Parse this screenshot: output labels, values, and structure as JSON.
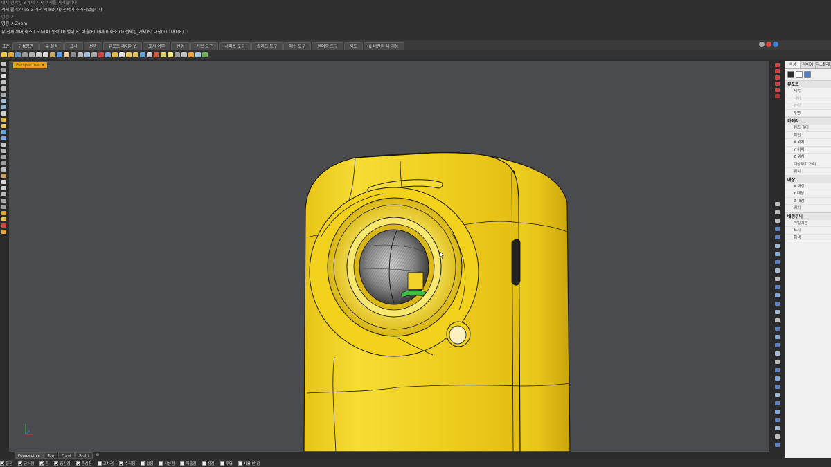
{
  "command_history": {
    "lines": [
      "배치 선택된 3 개의 가시 객체를 처리합니다",
      "객체 폴리서피스 3 개의 서브D(가) 선택에 추가되었습니다",
      "명령 ↗",
      "명령 ↗ Zoom"
    ],
    "prompt": "뷰 전체 확대/축소 ( 모두(A)  동적(D)  범위(E)  배율(F)  확대(I)  축소(O)  선택된_개체(S)  대상(T)  1대1(R) ):"
  },
  "tabs": [
    "표준",
    "구성평면",
    "뷰 설정",
    "표시",
    "선택",
    "뷰포트 레이아웃",
    "표시 여부",
    "변형",
    "커브 도구",
    "서피스 도구",
    "솔리드 도구",
    "메쉬 도구",
    "렌더링 도구",
    "제도",
    "8 버전의 새 기능"
  ],
  "viewport": {
    "label": "Perspective",
    "tabs": [
      "Perspective",
      "Top",
      "Front",
      "Right"
    ],
    "active_tab": "Perspective",
    "add_tab": "⊕"
  },
  "panel": {
    "tabs": [
      "속성",
      "레이어",
      "디스플레이"
    ],
    "sections": [
      {
        "title": "뷰포트",
        "rows": [
          {
            "label": "제목",
            "dim": false
          },
          {
            "label": "너비",
            "dim": true
          },
          {
            "label": "높이",
            "dim": true
          },
          {
            "label": "투영",
            "dim": false
          }
        ]
      },
      {
        "title": "카메라",
        "rows": [
          {
            "label": "렌즈 길이",
            "dim": false
          },
          {
            "label": "회전",
            "dim": false
          },
          {
            "label": "X 위치",
            "dim": false
          },
          {
            "label": "Y 위치",
            "dim": false
          },
          {
            "label": "Z 위치",
            "dim": false
          },
          {
            "label": "대상까지 거리",
            "dim": false
          },
          {
            "label": "위치",
            "dim": false
          }
        ]
      },
      {
        "title": "대상",
        "rows": [
          {
            "label": "X 대상",
            "dim": false
          },
          {
            "label": "Y 대상",
            "dim": false
          },
          {
            "label": "Z 대상",
            "dim": false
          },
          {
            "label": "위치",
            "dim": false
          }
        ]
      },
      {
        "title": "배경무늬",
        "rows": [
          {
            "label": "파일이름",
            "dim": false
          },
          {
            "label": "표시",
            "dim": false
          },
          {
            "label": "회색",
            "dim": false
          }
        ]
      }
    ]
  },
  "osnap": [
    {
      "label": "끝점",
      "checked": true
    },
    {
      "label": "근처점",
      "checked": true
    },
    {
      "label": "점",
      "checked": true
    },
    {
      "label": "중간점",
      "checked": true
    },
    {
      "label": "중심점",
      "checked": true
    },
    {
      "label": "교차점",
      "checked": false
    },
    {
      "label": "수직점",
      "checked": true
    },
    {
      "label": "접점",
      "checked": false
    },
    {
      "label": "사분점",
      "checked": false
    },
    {
      "label": "매듭점",
      "checked": false
    },
    {
      "label": "정점",
      "checked": false
    },
    {
      "label": "투영",
      "checked": false
    },
    {
      "label": "사용 안 함",
      "checked": false
    }
  ],
  "colors": {
    "viewport_bg": "#4a4b4e",
    "model_yellow": "#f2d21c",
    "label_orange": "#e9a21b",
    "panel_bg": "#f0f0f0"
  }
}
